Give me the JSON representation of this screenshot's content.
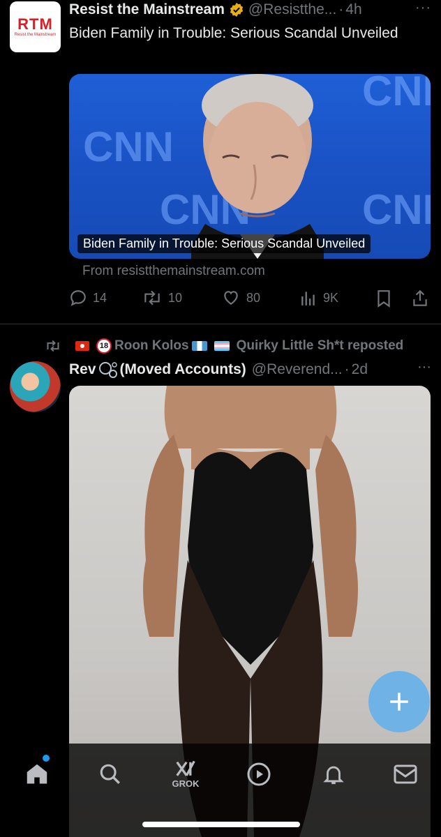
{
  "tweet1": {
    "avatar_text": "RTM",
    "avatar_subtext": "Resist the Mainstream",
    "author_name": "Resist the Mainstream",
    "handle": "@Resistthe...",
    "separator": "·",
    "time": "4h",
    "more": "···",
    "text": "Biden Family in Trouble: Serious Scandal Unveiled",
    "card": {
      "caption": "Biden Family in Trouble: Serious Scandal Unveiled",
      "source": "From resistthemainstream.com",
      "bg_watermark": "CNN"
    },
    "actions": {
      "replies": "14",
      "reposts": "10",
      "likes": "80",
      "views": "9K"
    }
  },
  "tweet2": {
    "repost_by": "Roon Kolos",
    "repost_suffix": "Quirky Little Sh*t reposted",
    "badge_18": "18",
    "author_name_prefix": "Rev",
    "author_name_suffix": "(Moved Accounts)",
    "handle": "@Reverend...",
    "separator": "·",
    "time": "2d",
    "more": "···"
  },
  "nav": {
    "grok_label": "GROK"
  },
  "colors": {
    "background": "#000000",
    "text": "#e7e9ea",
    "muted": "#71767b",
    "accent": "#1d9bf0",
    "fab": "#6fb2e6",
    "verified": "#e8b00f"
  }
}
